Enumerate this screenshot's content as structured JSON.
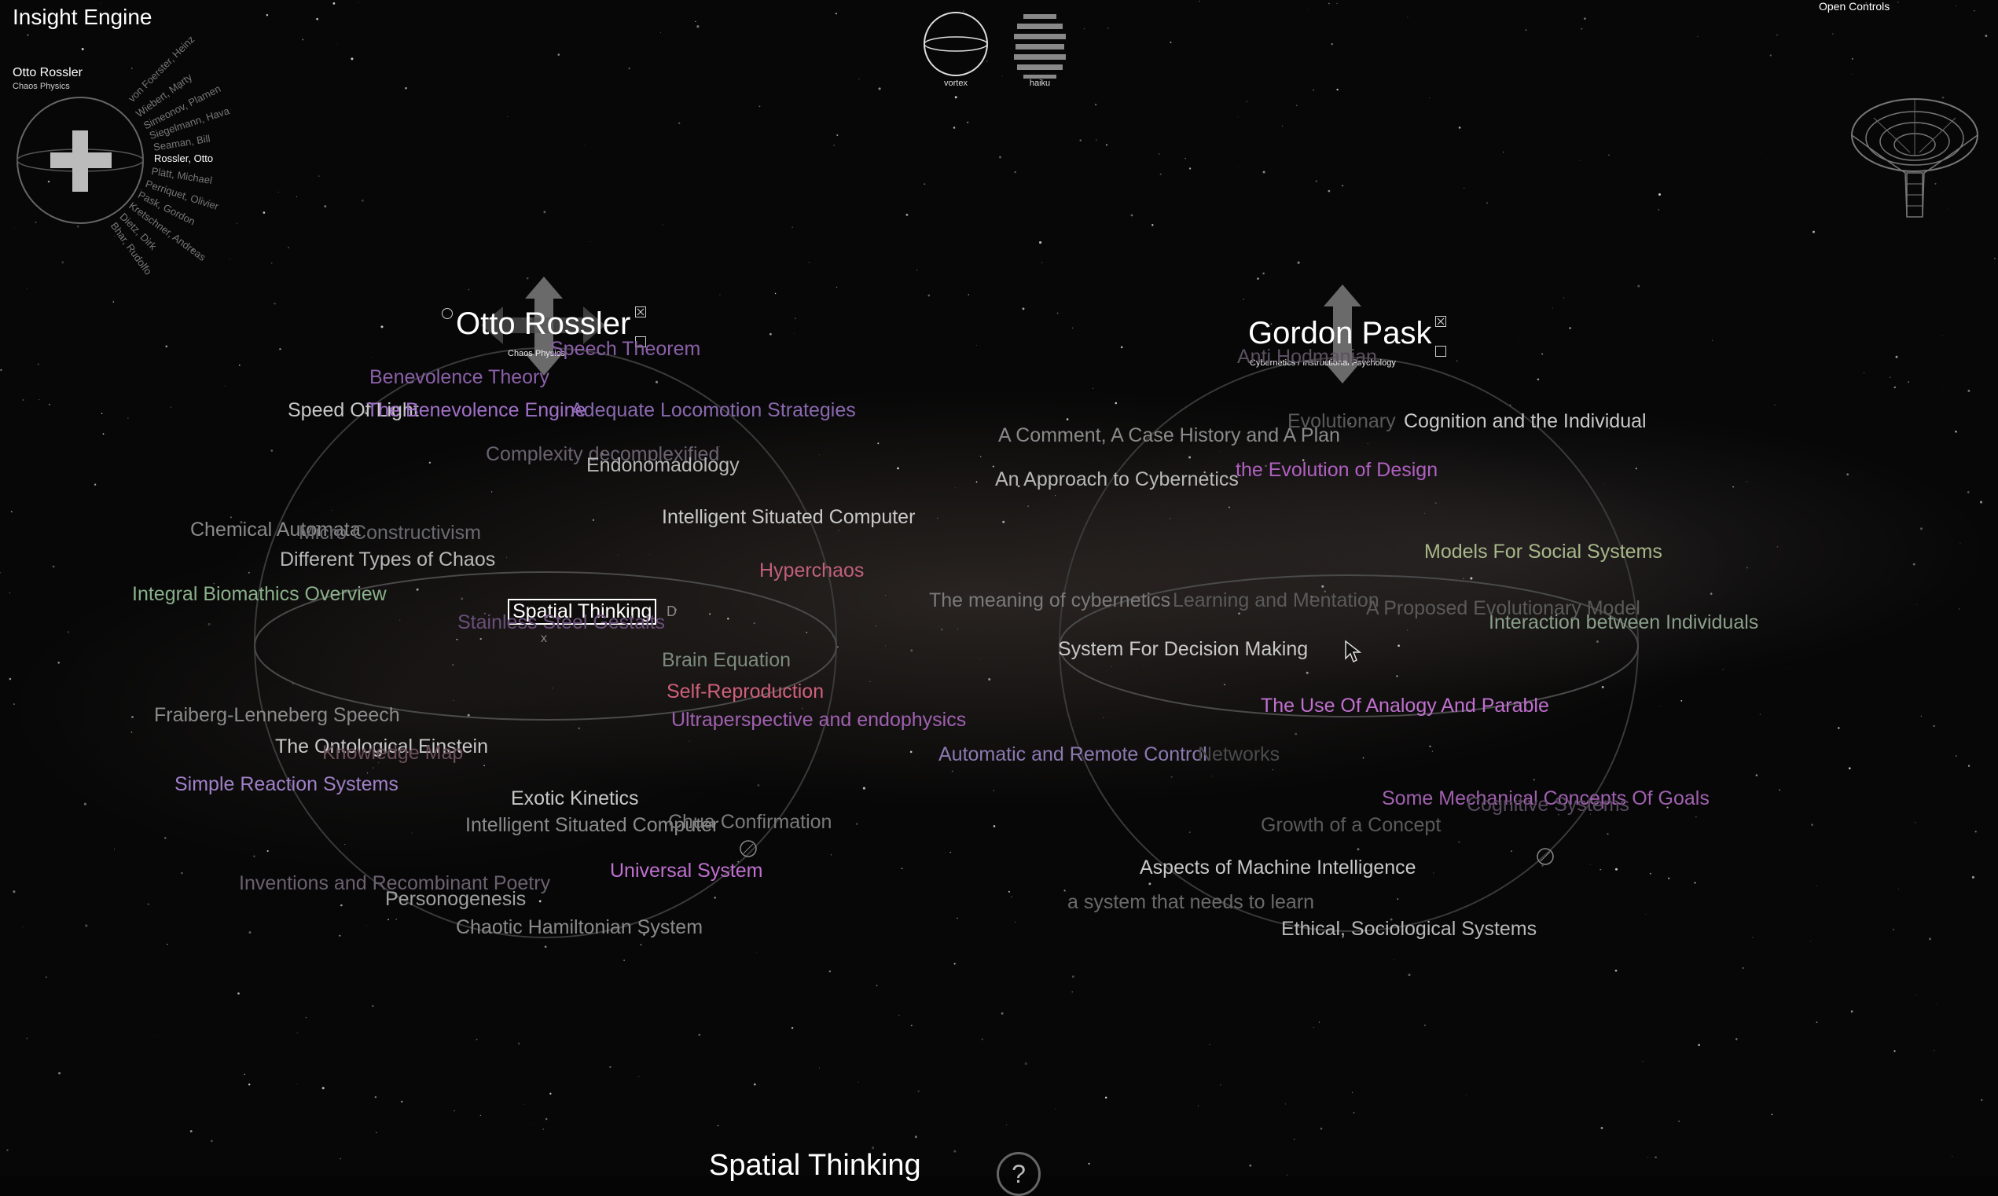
{
  "app": {
    "title": "Insight Engine",
    "open_controls": "Open Controls"
  },
  "mini_nav": {
    "current_name": "Otto Rossler",
    "current_field": "Chaos Physics",
    "people": [
      "von Foerster, Heinz",
      "Wiebert, Marty",
      "Simeonov, Plamen",
      "Siegelmann, Hava",
      "Seaman, Bill",
      "Rossler, Otto",
      "Platt, Michael",
      "Perriquet, Olivier",
      "Pask, Gordon",
      "Kretschner, Andreas",
      "Dietz, Dirk",
      "Bhar, Rudolfo"
    ],
    "active_person": "Rossler, Otto"
  },
  "view_modes": [
    {
      "label": "vortex",
      "icon": "sphere-icon"
    },
    {
      "label": "haiku",
      "icon": "haiku-lines-icon"
    }
  ],
  "nodes": [
    {
      "name": "Otto Rossler",
      "field": "Chaos Physics",
      "topics": [
        {
          "text": "Speech Theorem",
          "color": "#8a5fa8"
        },
        {
          "text": "Benevolence Theory",
          "color": "#8a5fa8"
        },
        {
          "text": "Speed Of Light",
          "color": "#c8c8c8"
        },
        {
          "text": "The Benevolence Engine",
          "color": "#a070c8"
        },
        {
          "text": "Adequate Locomotion Strategies",
          "color": "#8a68b0"
        },
        {
          "text": "Complexity decomplexified",
          "color": "#6a6270"
        },
        {
          "text": "Endonomadology",
          "color": "#b8b8b8"
        },
        {
          "text": "Intelligent Situated Computer",
          "color": "#c8c8c8"
        },
        {
          "text": "Chemical Automata",
          "color": "#8a8a8a"
        },
        {
          "text": "Micro Constructivism",
          "color": "#6a6a70"
        },
        {
          "text": "Different Types of Chaos",
          "color": "#b8b8b8"
        },
        {
          "text": "Hyperchaos",
          "color": "#c0607a"
        },
        {
          "text": "Integral Biomathics Overview",
          "color": "#8ab08a"
        },
        {
          "text": "Spatial Thinking",
          "color": "#ffffff"
        },
        {
          "text": "Stainless Steel Gestalts",
          "color": "#6a4f7a"
        },
        {
          "text": "Brain Equation",
          "color": "#7c8a7c"
        },
        {
          "text": "Self-Reproduction",
          "color": "#d0607a"
        },
        {
          "text": "Ultraperspective and endophysics",
          "color": "#a060b0"
        },
        {
          "text": "Fraiberg-Lenneberg Speech",
          "color": "#8a8a8a"
        },
        {
          "text": "The Ontological Einstein",
          "color": "#c8c8c8"
        },
        {
          "text": "Knowledge Map",
          "color": "#6a4f5a"
        },
        {
          "text": "Simple Reaction Systems",
          "color": "#a080c8"
        },
        {
          "text": "Exotic Kinetics",
          "color": "#c8c8c8"
        },
        {
          "text": "Intelligent Situated Computer",
          "color": "#8a8a8a"
        },
        {
          "text": "Chua Confirmation",
          "color": "#7a7a7a"
        },
        {
          "text": "Universal System",
          "color": "#c070d0"
        },
        {
          "text": "Inventions and Recombinant Poetry",
          "color": "#6a6070"
        },
        {
          "text": "Personogenesis",
          "color": "#a0a0a0"
        },
        {
          "text": "Chaotic Hamiltonian System",
          "color": "#8a8a8a"
        }
      ]
    },
    {
      "name": "Gordon Pask",
      "field": "Cybernetics / Instructional Psychology",
      "topics": [
        {
          "text": "Anti Hodmanian",
          "color": "#5a5060"
        },
        {
          "text": "Evolutionary",
          "color": "#5a5a5a"
        },
        {
          "text": "Cognition and the Individual",
          "color": "#c8c8c8"
        },
        {
          "text": "A Comment, A Case History and A Plan",
          "color": "#8a8a8a"
        },
        {
          "text": "the Evolution of Design",
          "color": "#b060c0"
        },
        {
          "text": "An Approach to Cybernetics",
          "color": "#b8b8b8"
        },
        {
          "text": "Models For Social Systems",
          "color": "#a8b888"
        },
        {
          "text": "The meaning of cybernetics",
          "color": "#7a7a7a"
        },
        {
          "text": "Learning and Mentation",
          "color": "#5a5a5a"
        },
        {
          "text": "A Proposed Evolutionary Model",
          "color": "#5a5a5a"
        },
        {
          "text": "Interaction between Individuals",
          "color": "#8aa08a"
        },
        {
          "text": "System For Decision Making",
          "color": "#c8c8c8"
        },
        {
          "text": "The Use Of Analogy And Parable",
          "color": "#c070d0"
        },
        {
          "text": "Automatic and Remote Control",
          "color": "#8a7ab0"
        },
        {
          "text": "Networks",
          "color": "#4a4a4a"
        },
        {
          "text": "Some Mechanical Concepts Of Goals",
          "color": "#a060b0"
        },
        {
          "text": "Cognitive Systems",
          "color": "#5a4a60"
        },
        {
          "text": "Growth of a Concept",
          "color": "#5a5a5a"
        },
        {
          "text": "Aspects of Machine Intelligence",
          "color": "#c8c8c8"
        },
        {
          "text": "a system that needs to learn",
          "color": "#6a6a6a"
        },
        {
          "text": "Ethical, Sociological Systems",
          "color": "#b8b8b8"
        }
      ]
    }
  ],
  "selected_topic": {
    "title": "Spatial Thinking",
    "help": "?"
  },
  "selection_markers": {
    "d_key": "D",
    "x_key": "x"
  },
  "colors": {
    "background": "#050505",
    "ring": "#3a3a3a",
    "accent": "#ffffff"
  }
}
